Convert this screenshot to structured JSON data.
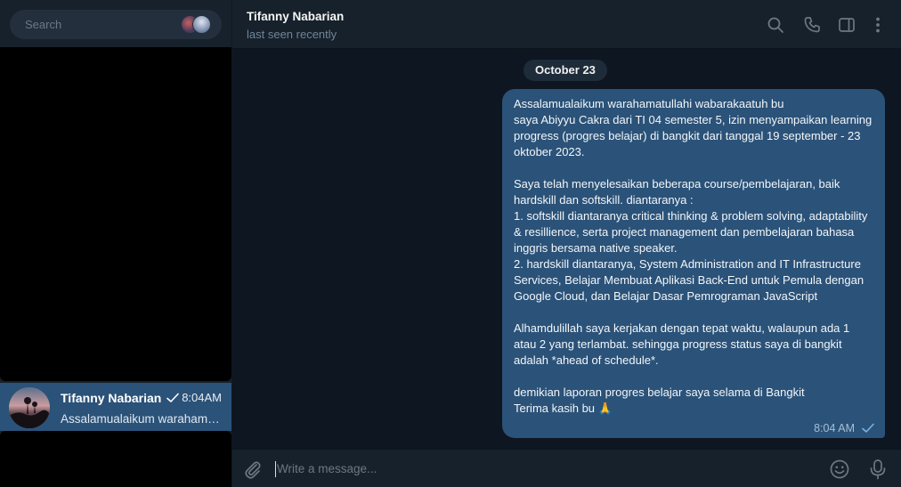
{
  "search": {
    "placeholder": "Search"
  },
  "chat_list": [
    {
      "name": "Tifanny Nabarian",
      "time": "8:04AM",
      "preview": "Assalamualaikum warahamatullahi wabarakaatuh bu",
      "read": true
    }
  ],
  "header": {
    "name": "Tifanny Nabarian",
    "status": "last seen recently",
    "icons": [
      "search-icon",
      "phone-icon",
      "sidebar-toggle-icon",
      "more-vertical-icon"
    ]
  },
  "conversation": {
    "date": "October 23",
    "message": {
      "text": "Assalamualaikum warahamatullahi wabarakaatuh bu\nsaya Abiyyu Cakra dari TI 04 semester 5, izin menyampaikan learning progress (progres belajar) di bangkit dari tanggal 19 september - 23 oktober 2023.\n\nSaya telah menyelesaikan beberapa course/pembelajaran, baik hardskill dan softskill. diantaranya :\n1. softskill diantaranya critical thinking & problem solving, adaptability & resillience, serta project management dan pembelajaran bahasa inggris bersama native speaker.\n2. hardskill diantaranya, System Administration and IT Infrastructure Services, Belajar Membuat Aplikasi Back-End untuk Pemula dengan Google Cloud, dan Belajar Dasar Pemrograman JavaScript\n\nAlhamdulillah saya kerjakan dengan tepat waktu, walaupun ada 1 atau 2 yang terlambat. sehingga progress status saya di bangkit adalah *ahead of schedule*.\n\ndemikian laporan progres belajar saya selama di Bangkit\nTerima kasih bu 🙏",
      "time": "8:04 AM",
      "status": "sent"
    }
  },
  "composer": {
    "placeholder": "Write a message..."
  },
  "colors": {
    "background": "#0e1621",
    "panel": "#17212b",
    "accent_bubble": "#2b5278",
    "muted_text": "#708499"
  }
}
